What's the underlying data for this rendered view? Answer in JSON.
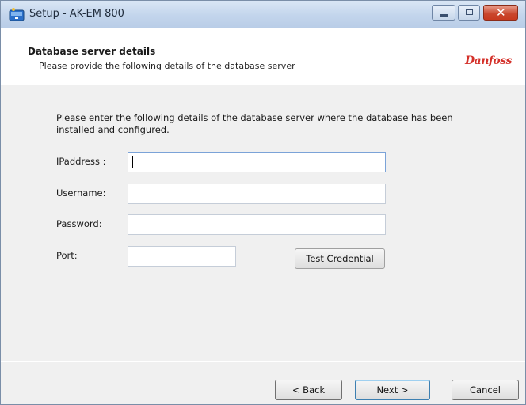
{
  "window": {
    "title": "Setup - AK-EM 800",
    "close_glyph": "✕"
  },
  "header": {
    "title": "Database server details",
    "subtitle": "Please provide the following details of the database server",
    "logo_text": "Danfoss"
  },
  "form": {
    "intro": "Please enter the following details of the database server where the database has been installed and configured.",
    "ip": {
      "label": "IPaddress :",
      "value": ""
    },
    "username": {
      "label": "Username:",
      "value": ""
    },
    "password": {
      "label": "Password:",
      "value": ""
    },
    "port": {
      "label": "Port:",
      "value": ""
    },
    "test_button": "Test Credential"
  },
  "footer": {
    "back": "< Back",
    "next": "Next >",
    "cancel": "Cancel"
  },
  "colors": {
    "logo_red": "#d4312a",
    "focus_border": "#7ba3d8",
    "titlebar": "#c3d5ec"
  }
}
